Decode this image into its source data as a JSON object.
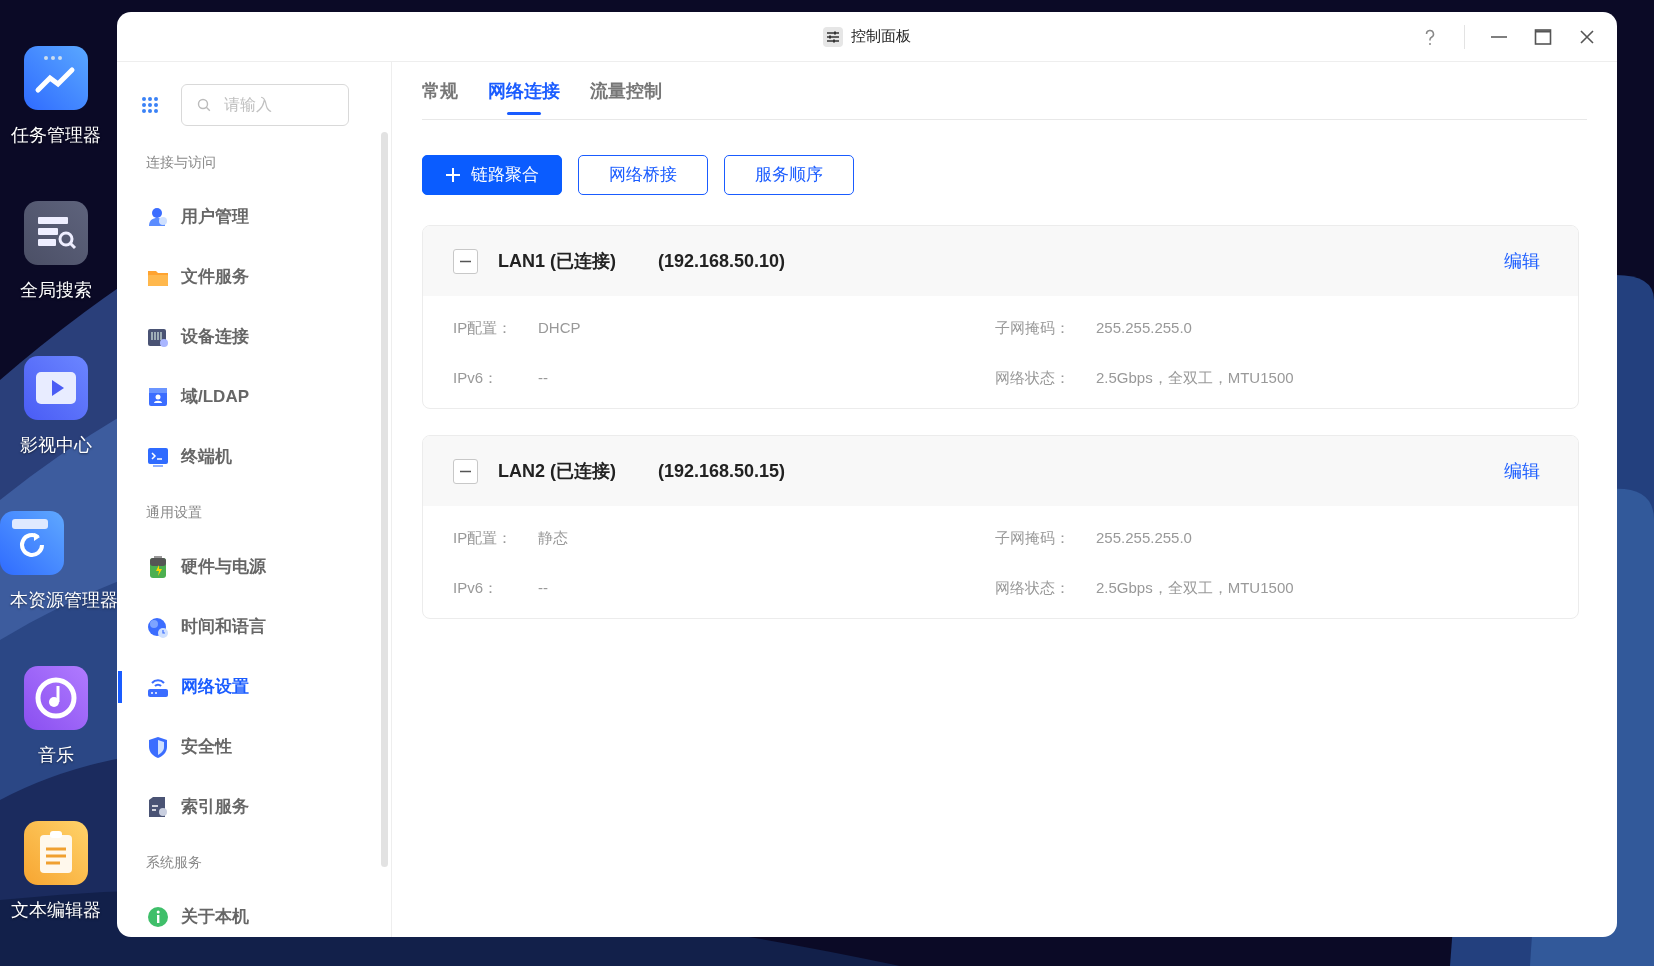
{
  "desktop": {
    "icons": [
      {
        "label": "任务管理器",
        "kind": "monitor"
      },
      {
        "label": "全局搜索",
        "kind": "search"
      },
      {
        "label": "影视中心",
        "kind": "video"
      },
      {
        "label": "本资源管理器",
        "kind": "backup"
      },
      {
        "label": "音乐",
        "kind": "music"
      },
      {
        "label": "文本编辑器",
        "kind": "notes"
      }
    ]
  },
  "window": {
    "title": "控制面板"
  },
  "sidebar": {
    "search": {
      "placeholder": "请输入"
    },
    "sections": [
      {
        "title": "连接与访问",
        "items": [
          {
            "label": "用户管理",
            "kind": "user",
            "selected": false
          },
          {
            "label": "文件服务",
            "kind": "folder",
            "selected": false
          },
          {
            "label": "设备连接",
            "kind": "device",
            "selected": false
          },
          {
            "label": "域/LDAP",
            "kind": "ldap",
            "selected": false
          },
          {
            "label": "终端机",
            "kind": "terminal",
            "selected": false
          }
        ]
      },
      {
        "title": "通用设置",
        "items": [
          {
            "label": "硬件与电源",
            "kind": "battery",
            "selected": false
          },
          {
            "label": "时间和语言",
            "kind": "globe",
            "selected": false
          },
          {
            "label": "网络设置",
            "kind": "router",
            "selected": true
          },
          {
            "label": "安全性",
            "kind": "shield",
            "selected": false
          },
          {
            "label": "索引服务",
            "kind": "index",
            "selected": false
          }
        ]
      },
      {
        "title": "系统服务",
        "items": [
          {
            "label": "关于本机",
            "kind": "info",
            "selected": false
          }
        ]
      }
    ]
  },
  "tabs": [
    {
      "label": "常规",
      "selected": false
    },
    {
      "label": "网络连接",
      "selected": true
    },
    {
      "label": "流量控制",
      "selected": false
    }
  ],
  "actions": [
    {
      "label": "链路聚合",
      "kind": "primary"
    },
    {
      "label": "网络桥接",
      "kind": "outline"
    },
    {
      "label": "服务顺序",
      "kind": "outline"
    }
  ],
  "interfaces": [
    {
      "name": "LAN1 (已连接)",
      "address": "(192.168.50.10)",
      "expanded": true,
      "edit": "编辑",
      "fields": [
        {
          "label": "IP配置：",
          "value": "DHCP"
        },
        {
          "label": "子网掩码：",
          "value": "255.255.255.0"
        },
        {
          "label": "IPv6：",
          "value": "--"
        },
        {
          "label": "网络状态：",
          "value": "2.5Gbps，全双工，MTU1500"
        }
      ]
    },
    {
      "name": "LAN2 (已连接)",
      "address": "(192.168.50.15)",
      "expanded": true,
      "edit": "编辑",
      "fields": [
        {
          "label": "IP配置：",
          "value": "静态"
        },
        {
          "label": "子网掩码：",
          "value": "255.255.255.0"
        },
        {
          "label": "IPv6：",
          "value": "--"
        },
        {
          "label": "网络状态：",
          "value": "2.5Gbps，全双工，MTU1500"
        }
      ]
    }
  ]
}
